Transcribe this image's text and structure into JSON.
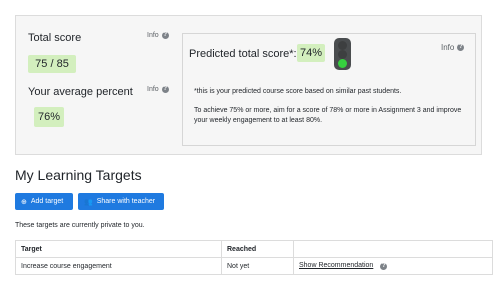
{
  "summary": {
    "total_score_label": "Total score",
    "total_score_value": "75 / 85",
    "avg_percent_label": "Your average percent",
    "avg_percent_value": "76%",
    "info_label": "Info"
  },
  "prediction": {
    "label": "Predicted total score*:",
    "value": "74%",
    "info_label": "Info",
    "note": "*this is your predicted course score based on similar past students.",
    "advice": "To achieve 75% or more, aim for a score of 78% or more in Assignment 3 and improve your weekly engagement to at least 80%.",
    "traffic_light": {
      "active": "green",
      "colors": {
        "red": "#3d3f40",
        "amber": "#3d3f40",
        "green": "#36d13f"
      }
    }
  },
  "targets": {
    "heading": "My Learning Targets",
    "add_button": "Add target",
    "share_button": "Share with teacher",
    "privacy_note": "These targets are currently private to you.",
    "columns": [
      "Target",
      "Reached",
      ""
    ],
    "rows": [
      {
        "target": "Increase course engagement",
        "reached": "Not yet",
        "action": "Show Recommendation"
      }
    ]
  }
}
